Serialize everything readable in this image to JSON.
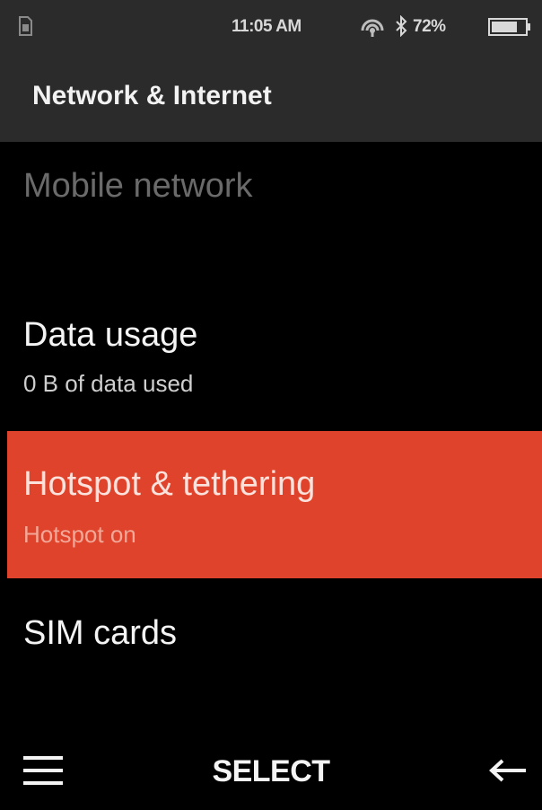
{
  "status_bar": {
    "time": "11:05 AM",
    "battery_percent": "72%",
    "icons": [
      "sim-icon",
      "hotspot-icon",
      "bluetooth-icon",
      "battery-icon"
    ]
  },
  "header": {
    "title": "Network & Internet"
  },
  "menu": {
    "items": [
      {
        "label": "Mobile network",
        "subtitle": "",
        "state": "disabled"
      },
      {
        "label": "Data usage",
        "subtitle": "0 B of data used",
        "state": "normal"
      },
      {
        "label": "Hotspot & tethering",
        "subtitle": "Hotspot on",
        "state": "selected"
      },
      {
        "label": "SIM cards",
        "subtitle": "",
        "state": "normal"
      }
    ]
  },
  "softkeys": {
    "left_icon": "menu-icon",
    "center_label": "SELECT",
    "right_icon": "back-arrow-icon"
  },
  "colors": {
    "highlight": "#e0432b",
    "bar_background": "#2b2b2b",
    "background": "#000000"
  }
}
